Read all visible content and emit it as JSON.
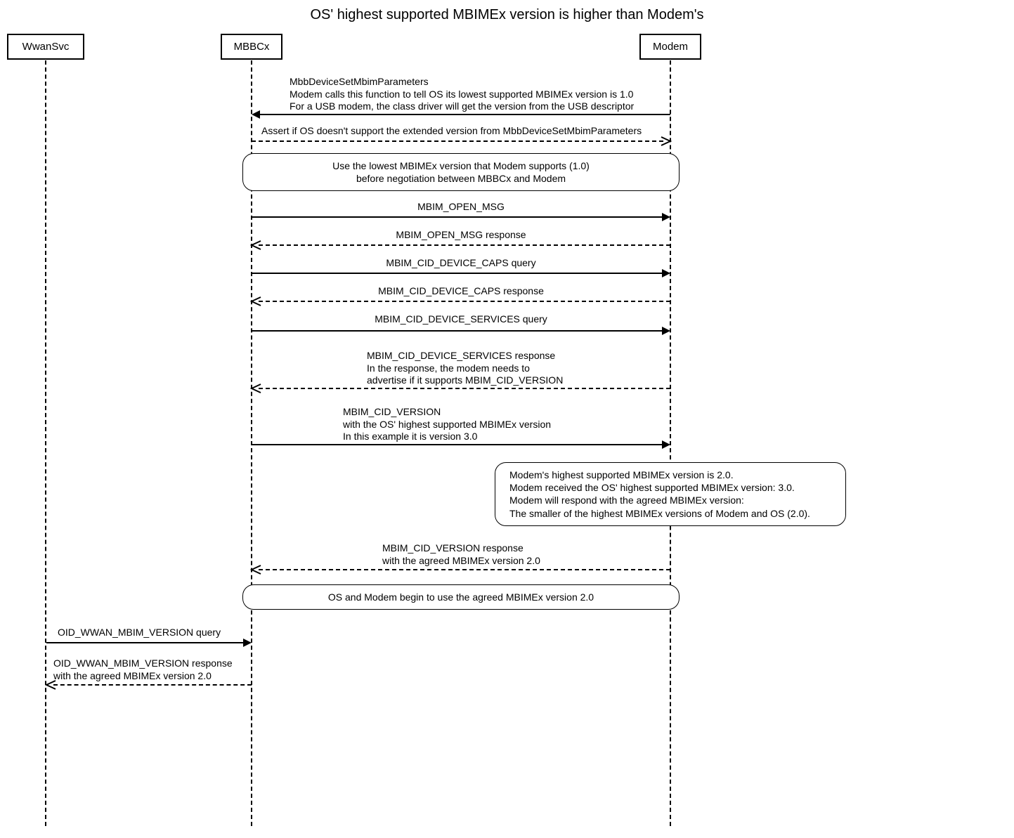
{
  "title": "OS' highest supported MBIMEx version is higher than Modem's",
  "actors": {
    "wwansvc": "WwanSvc",
    "mbbcx": "MBBCx",
    "modem": "Modem"
  },
  "messages": {
    "m1": "MbbDeviceSetMbimParameters\nModem calls this function to tell OS its lowest supported MBIMEx version is 1.0\nFor a USB modem, the class driver will get the version from the USB descriptor",
    "m2": "Assert if OS doesn't support the extended version from MbbDeviceSetMbimParameters",
    "m3": "MBIM_OPEN_MSG",
    "m4": "MBIM_OPEN_MSG response",
    "m5": "MBIM_CID_DEVICE_CAPS query",
    "m6": "MBIM_CID_DEVICE_CAPS response",
    "m7": "MBIM_CID_DEVICE_SERVICES query",
    "m8": "MBIM_CID_DEVICE_SERVICES response\nIn the response, the modem needs to\nadvertise if it supports MBIM_CID_VERSION",
    "m9": "MBIM_CID_VERSION\nwith the OS' highest supported MBIMEx version\nIn this example it is version 3.0",
    "m10": "MBIM_CID_VERSION response\nwith the agreed MBIMEx version 2.0",
    "m11": "OID_WWAN_MBIM_VERSION query",
    "m12": "OID_WWAN_MBIM_VERSION response\nwith the agreed MBIMEx version 2.0"
  },
  "notes": {
    "n1": "Use the lowest MBIMEx version that Modem supports (1.0)\nbefore negotiation between MBBCx and Modem",
    "n2": "Modem's highest supported MBIMEx version is 2.0.\nModem received the OS' highest supported MBIMEx version: 3.0.\nModem will respond with the agreed MBIMEx version:\nThe smaller of the highest MBIMEx versions of Modem and OS (2.0).",
    "n3": "OS and Modem begin to use the agreed MBIMEx version 2.0"
  },
  "chart_data": {
    "type": "sequence-diagram",
    "title": "OS' highest supported MBIMEx version is higher than Modem's",
    "participants": [
      "WwanSvc",
      "MBBCx",
      "Modem"
    ],
    "events": [
      {
        "from": "Modem",
        "to": "MBBCx",
        "kind": "message",
        "style": "solid",
        "text": "MbbDeviceSetMbimParameters — Modem calls this function to tell OS its lowest supported MBIMEx version is 1.0. For a USB modem, the class driver will get the version from the USB descriptor"
      },
      {
        "from": "MBBCx",
        "to": "Modem",
        "kind": "message",
        "style": "dashed",
        "text": "Assert if OS doesn't support the extended version from MbbDeviceSetMbimParameters"
      },
      {
        "kind": "note",
        "over": [
          "MBBCx",
          "Modem"
        ],
        "text": "Use the lowest MBIMEx version that Modem supports (1.0) before negotiation between MBBCx and Modem"
      },
      {
        "from": "MBBCx",
        "to": "Modem",
        "kind": "message",
        "style": "solid",
        "text": "MBIM_OPEN_MSG"
      },
      {
        "from": "Modem",
        "to": "MBBCx",
        "kind": "message",
        "style": "dashed",
        "text": "MBIM_OPEN_MSG response"
      },
      {
        "from": "MBBCx",
        "to": "Modem",
        "kind": "message",
        "style": "solid",
        "text": "MBIM_CID_DEVICE_CAPS query"
      },
      {
        "from": "Modem",
        "to": "MBBCx",
        "kind": "message",
        "style": "dashed",
        "text": "MBIM_CID_DEVICE_CAPS response"
      },
      {
        "from": "MBBCx",
        "to": "Modem",
        "kind": "message",
        "style": "solid",
        "text": "MBIM_CID_DEVICE_SERVICES query"
      },
      {
        "from": "Modem",
        "to": "MBBCx",
        "kind": "message",
        "style": "dashed",
        "text": "MBIM_CID_DEVICE_SERVICES response. In the response, the modem needs to advertise if it supports MBIM_CID_VERSION"
      },
      {
        "from": "MBBCx",
        "to": "Modem",
        "kind": "message",
        "style": "solid",
        "text": "MBIM_CID_VERSION with the OS' highest supported MBIMEx version. In this example it is version 3.0"
      },
      {
        "kind": "note",
        "over": [
          "Modem"
        ],
        "text": "Modem's highest supported MBIMEx version is 2.0. Modem received the OS' highest supported MBIMEx version: 3.0. Modem will respond with the agreed MBIMEx version: The smaller of the highest MBIMEx versions of Modem and OS (2.0)."
      },
      {
        "from": "Modem",
        "to": "MBBCx",
        "kind": "message",
        "style": "dashed",
        "text": "MBIM_CID_VERSION response with the agreed MBIMEx version 2.0"
      },
      {
        "kind": "note",
        "over": [
          "MBBCx",
          "Modem"
        ],
        "text": "OS and Modem begin to use the agreed MBIMEx version 2.0"
      },
      {
        "from": "WwanSvc",
        "to": "MBBCx",
        "kind": "message",
        "style": "solid",
        "text": "OID_WWAN_MBIM_VERSION query"
      },
      {
        "from": "MBBCx",
        "to": "WwanSvc",
        "kind": "message",
        "style": "dashed",
        "text": "OID_WWAN_MBIM_VERSION response with the agreed MBIMEx version 2.0"
      }
    ]
  }
}
